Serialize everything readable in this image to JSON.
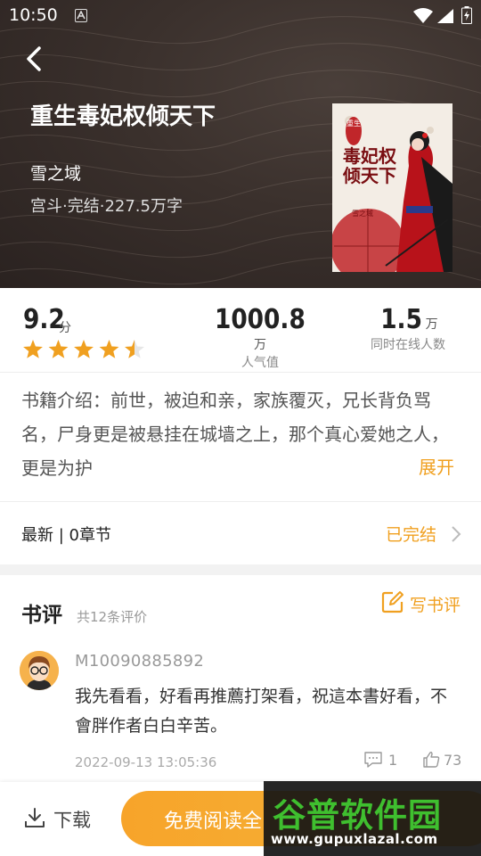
{
  "status_bar": {
    "time": "10:50"
  },
  "book": {
    "title": "重生毒妃权倾天下",
    "author": "雪之域",
    "meta": "宫斗·完结·227.5万字",
    "cover_title": "毒妃权倾天下",
    "cover_badge": "重生",
    "cover_author": "雪之域"
  },
  "stats": {
    "score": "9.2",
    "score_unit": "分",
    "rating": 4.5,
    "rating_max": 5,
    "popularity": {
      "value": "1000.8",
      "unit": "万",
      "label": "人气值"
    },
    "online": {
      "value": "1.5",
      "unit": "万",
      "label": "同时在线人数"
    }
  },
  "intro": {
    "text": "书籍介绍：前世，被迫和亲，家族覆灭，兄长背负骂名，尸身更是被悬挂在城墙之上，那个真心爱她之人，更是为护",
    "expand_label": "展开"
  },
  "chapters": {
    "latest_label": "最新 | 0章节",
    "status": "已完结"
  },
  "reviews": {
    "title": "书评",
    "count": "共12条评价",
    "write_label": "写书评",
    "items": [
      {
        "user": "M10090885892",
        "text": "我先看看，好看再推薦打架看，祝這本書好看，不會胖作者白白辛苦。",
        "time": "2022-09-13 13:05:36",
        "comments": "1",
        "likes": "73"
      }
    ]
  },
  "bottom": {
    "download_label": "下载",
    "read_label": "免费阅读全"
  },
  "watermark": {
    "logo": "谷普软件园",
    "url": "www.gupuxlazal.com"
  },
  "colors": {
    "accent": "#f0a020",
    "header_bg": "#3a302c",
    "star": "#f0a020"
  },
  "icons": [
    "back-arrow-icon",
    "wifi-icon",
    "signal-icon",
    "battery-icon",
    "star-icon",
    "chevron-right-icon",
    "edit-icon",
    "comment-icon",
    "thumb-up-icon",
    "download-icon"
  ]
}
